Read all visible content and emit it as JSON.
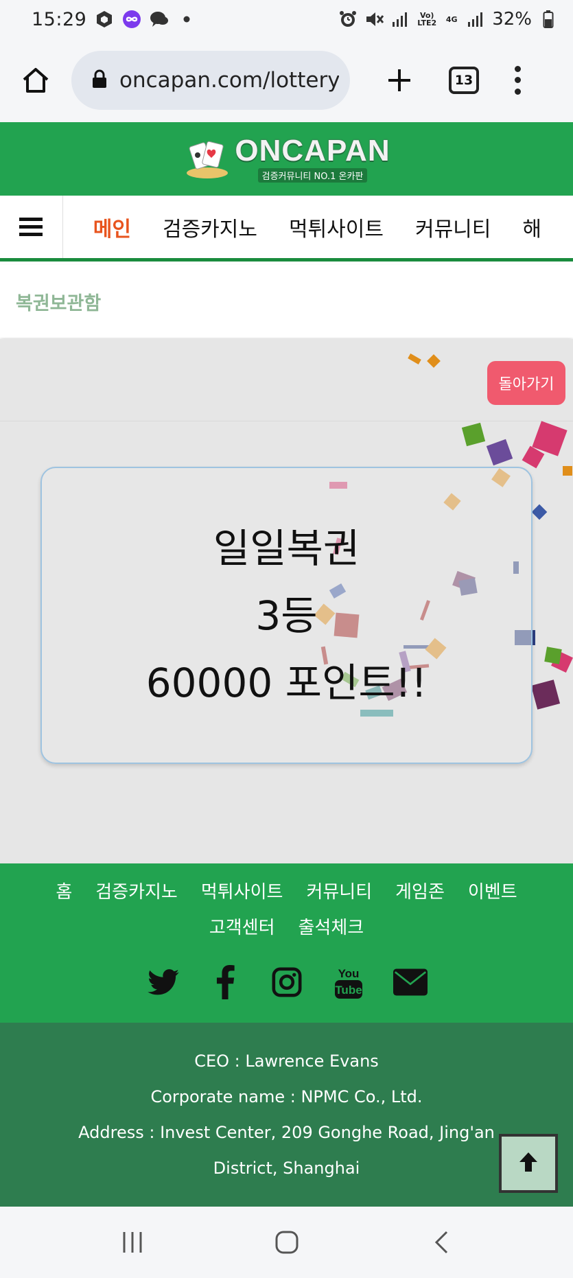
{
  "status_bar": {
    "time": "15:29",
    "network_label": "Vo) LTE2",
    "network_gen": "4G",
    "battery": "32%"
  },
  "browser": {
    "url": "oncapan.com/lottery",
    "tab_count": "13"
  },
  "site": {
    "logo_text": "ONCAPAN",
    "logo_tagline": "검증커뮤니티 NO.1 온카판",
    "brand_color": "#22a350"
  },
  "nav": {
    "items": [
      {
        "label": "메인",
        "active": true
      },
      {
        "label": "검증카지노",
        "active": false
      },
      {
        "label": "먹튀사이트",
        "active": false
      },
      {
        "label": "커뮤니티",
        "active": false
      },
      {
        "label": "해",
        "active": false
      }
    ]
  },
  "page": {
    "title": "복권보관함",
    "back_label": "돌아가기"
  },
  "result": {
    "line1": "일일복권",
    "line2": "3등",
    "line3": "60000 포인트!!"
  },
  "footer": {
    "links": [
      "홈",
      "검증카지노",
      "먹튀사이트",
      "커뮤니티",
      "게임존",
      "이벤트",
      "고객센터",
      "출석체크"
    ],
    "social": [
      "twitter-icon",
      "facebook-icon",
      "instagram-icon",
      "youtube-icon",
      "mail-icon"
    ],
    "youtube_text": [
      "You",
      "Tube"
    ],
    "ceo": "CEO : Lawrence Evans",
    "corporate": "Corporate name : NPMC Co., Ltd.",
    "address": "Address : Invest Center, 209 Gonghe Road, Jing'an District, Shanghai"
  }
}
